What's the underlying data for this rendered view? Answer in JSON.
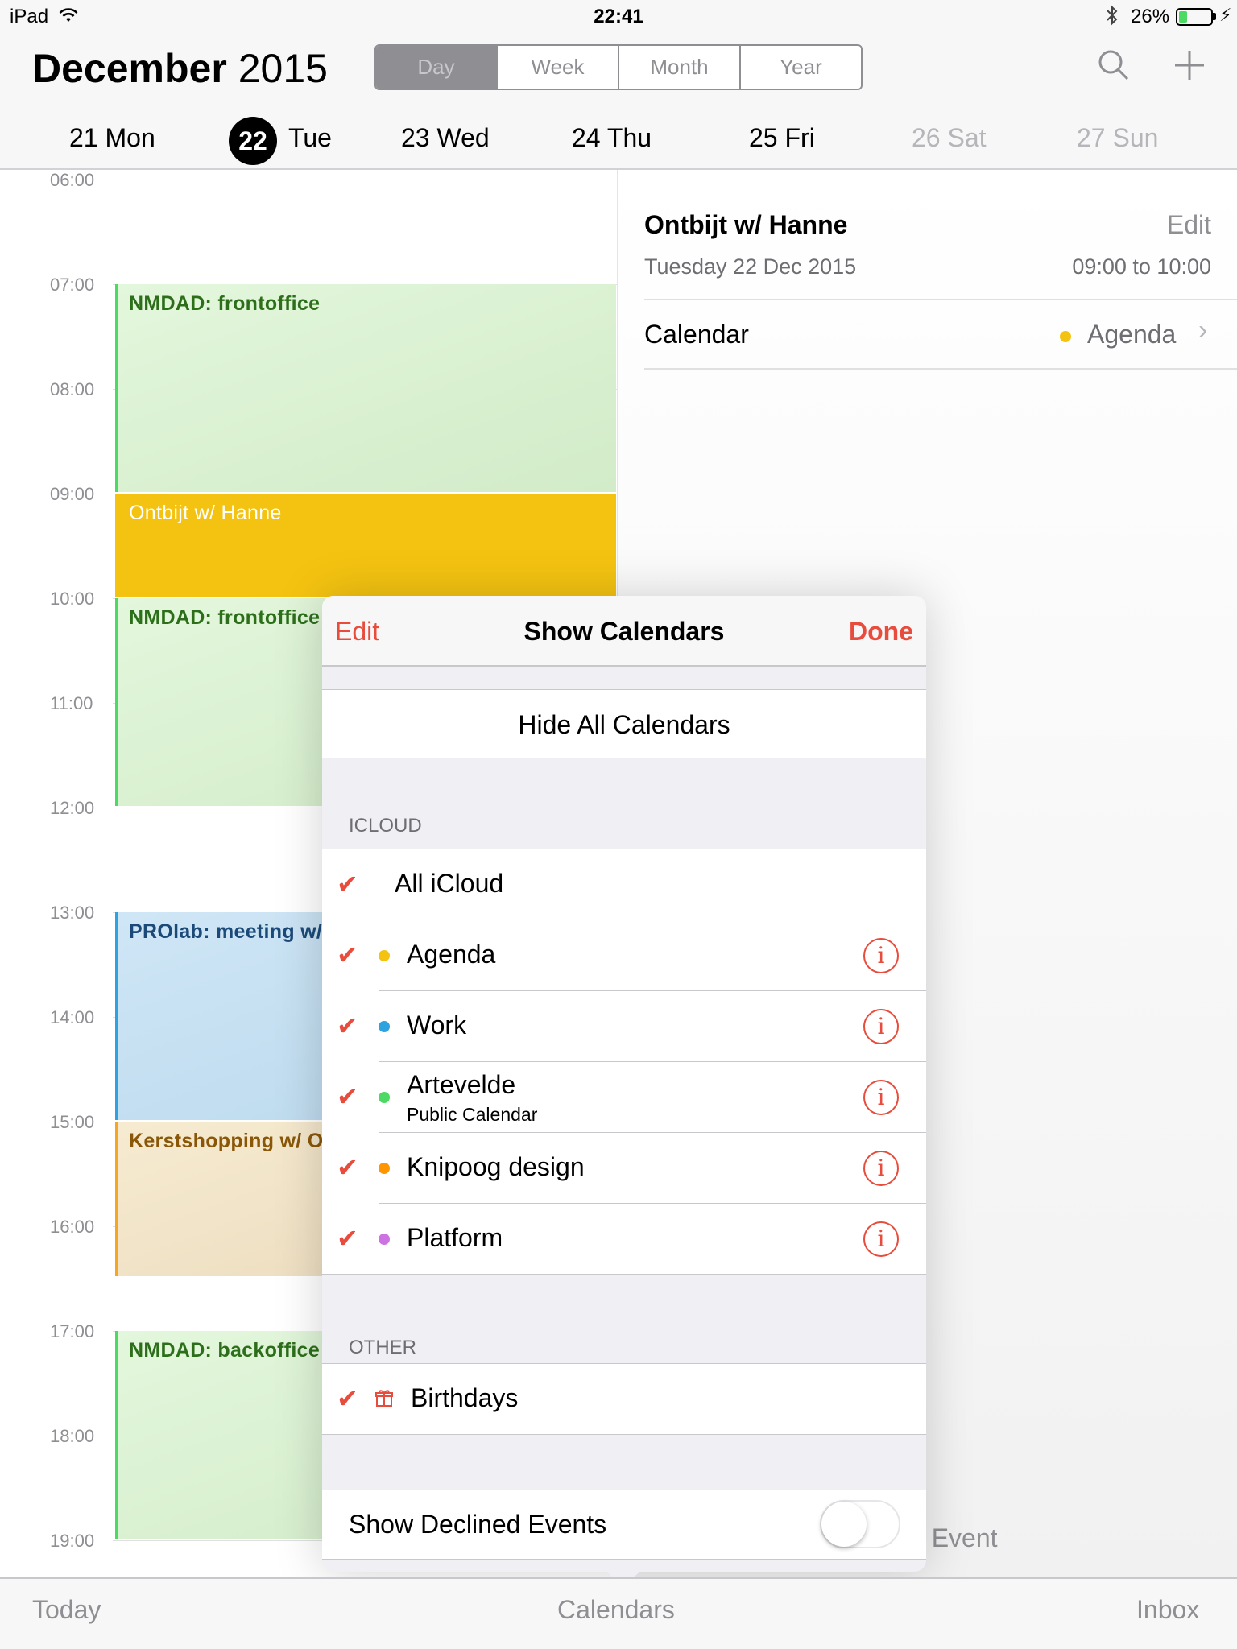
{
  "status_bar": {
    "carrier": "iPad",
    "time": "22:41",
    "battery_pct": "26%",
    "battery_level": 0.26,
    "icons": [
      "wifi-icon",
      "bluetooth-icon",
      "battery-icon",
      "charging-icon"
    ]
  },
  "header": {
    "month": "December",
    "year": "2015",
    "views": [
      "Day",
      "Week",
      "Month",
      "Year"
    ],
    "active_view": "Day",
    "icons": [
      "search-icon",
      "add-icon"
    ]
  },
  "days": [
    {
      "num": "21",
      "name": "Mon"
    },
    {
      "num": "22",
      "name": "Tue",
      "today": true
    },
    {
      "num": "23",
      "name": "Wed"
    },
    {
      "num": "24",
      "name": "Thu"
    },
    {
      "num": "25",
      "name": "Fri"
    },
    {
      "num": "26",
      "name": "Sat",
      "weekend": true
    },
    {
      "num": "27",
      "name": "Sun",
      "weekend": true
    }
  ],
  "hours": [
    "06:00",
    "07:00",
    "08:00",
    "09:00",
    "10:00",
    "11:00",
    "12:00",
    "13:00",
    "14:00",
    "15:00",
    "16:00",
    "17:00",
    "18:00",
    "19:00"
  ],
  "events": [
    {
      "title": "NMDAD: frontoffice",
      "color": "green"
    },
    {
      "title": "Ontbijt w/ Hanne",
      "color": "yellow"
    },
    {
      "title": "NMDAD: frontoffice",
      "color": "green"
    },
    {
      "title": "PROlab: meeting w/",
      "color": "blue"
    },
    {
      "title": "Kerstshopping w/ O",
      "color": "orange"
    },
    {
      "title": "NMDAD: backoffice",
      "color": "green"
    }
  ],
  "detail": {
    "title": "Ontbijt w/ Hanne",
    "edit": "Edit",
    "date": "Tuesday 22 Dec 2015",
    "time": "09:00 to 10:00",
    "calendar_label": "Calendar",
    "calendar_value": "Agenda",
    "calendar_color": "#f4c311",
    "partial_text": "e Event"
  },
  "popover": {
    "edit": "Edit",
    "title": "Show Calendars",
    "done": "Done",
    "hide_all": "Hide All Calendars",
    "icloud_header": "ICLOUD",
    "all_icloud": "All iCloud",
    "calendars": [
      {
        "name": "Agenda",
        "color": "#f4c311"
      },
      {
        "name": "Work",
        "color": "#2ea3e0"
      },
      {
        "name": "Artevelde",
        "sub": "Public Calendar",
        "color": "#4cd964"
      },
      {
        "name": "Knipoog design",
        "color": "#ff9500"
      },
      {
        "name": "Platform",
        "color": "#cc73e1"
      }
    ],
    "other_header": "OTHER",
    "birthdays": "Birthdays",
    "show_declined": "Show Declined Events",
    "show_declined_on": false
  },
  "tabbar": {
    "today": "Today",
    "calendars": "Calendars",
    "inbox": "Inbox"
  },
  "colors": {
    "accent_red": "#e74c3c",
    "today_circle": "#000000"
  }
}
